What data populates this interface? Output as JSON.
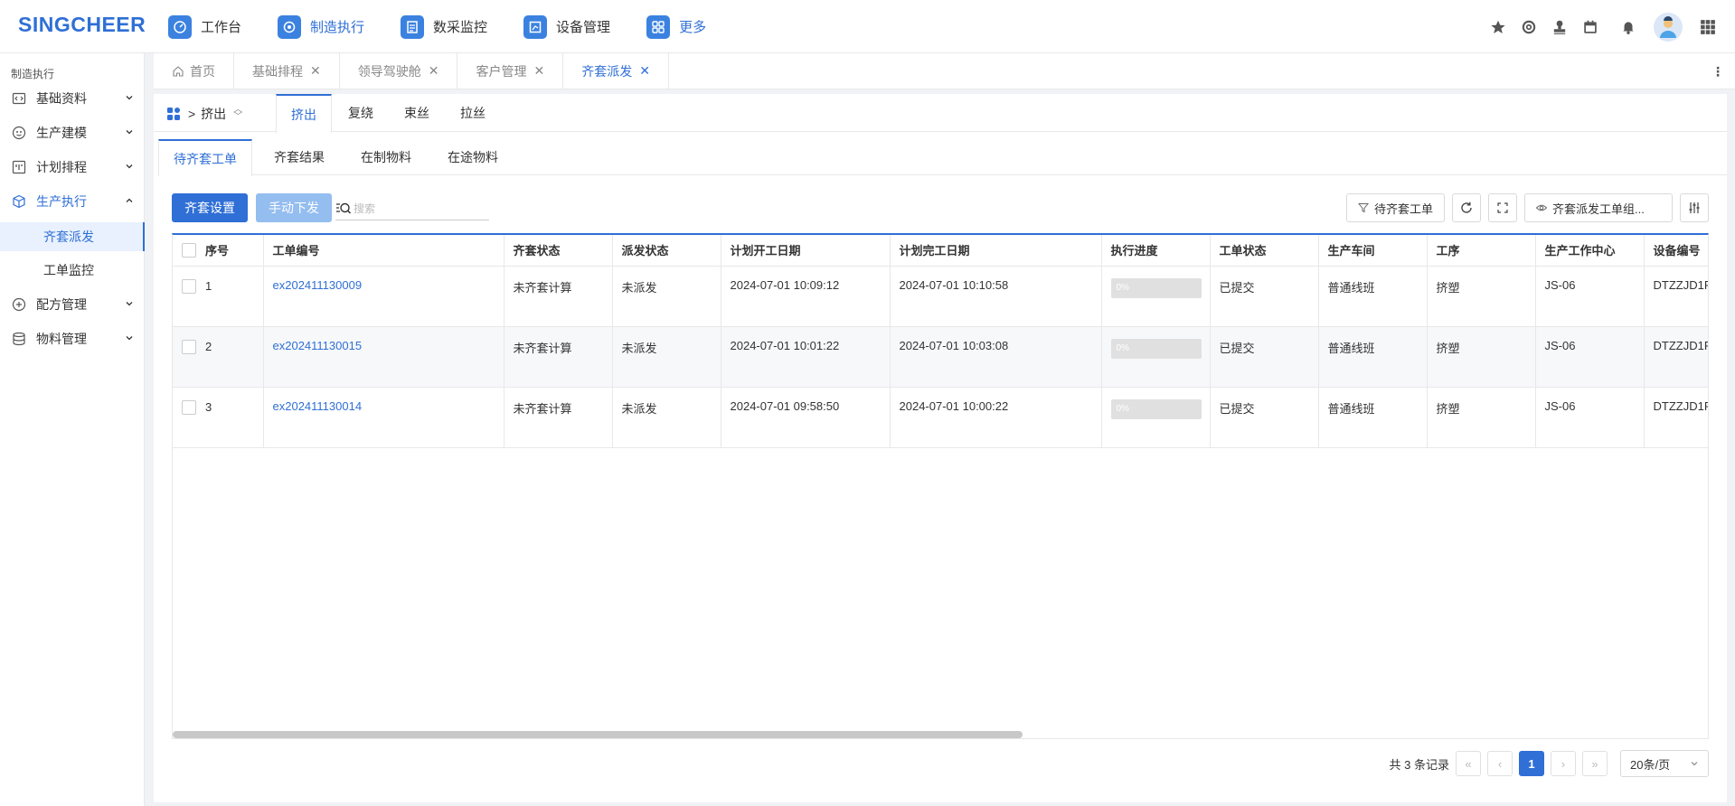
{
  "header": {
    "logo": "SINGCHEER",
    "nav": [
      {
        "label": "工作台",
        "icon": "dashboard-icon",
        "active": false
      },
      {
        "label": "制造执行",
        "icon": "manufacturing-icon",
        "active": true
      },
      {
        "label": "数采监控",
        "icon": "data-monitor-icon",
        "active": false
      },
      {
        "label": "设备管理",
        "icon": "equipment-icon",
        "active": false
      },
      {
        "label": "更多",
        "icon": "more-apps-icon",
        "active": false
      }
    ]
  },
  "sidebar": {
    "title": "制造执行",
    "items": [
      {
        "label": "基础资料"
      },
      {
        "label": "生产建模"
      },
      {
        "label": "计划排程"
      },
      {
        "label": "生产执行"
      },
      {
        "label": "配方管理"
      },
      {
        "label": "物料管理"
      }
    ],
    "subitems": [
      {
        "label": "齐套派发"
      },
      {
        "label": "工单监控"
      }
    ]
  },
  "tabs": [
    {
      "label": "首页"
    },
    {
      "label": "基础排程"
    },
    {
      "label": "领导驾驶舱"
    },
    {
      "label": "客户管理"
    },
    {
      "label": "齐套派发"
    }
  ],
  "process": {
    "crumb": "挤出",
    "tabs": [
      "挤出",
      "复绕",
      "束丝",
      "拉丝"
    ]
  },
  "subtabs": [
    "待齐套工单",
    "齐套结果",
    "在制物料",
    "在途物料"
  ],
  "toolbar": {
    "setup_label": "齐套设置",
    "manual_label": "手动下发",
    "search_placeholder": "搜索",
    "filter_label": "待齐套工单",
    "view_label": "齐套派发工单组..."
  },
  "table": {
    "headers": [
      "序号",
      "工单编号",
      "齐套状态",
      "派发状态",
      "计划开工日期",
      "计划完工日期",
      "执行进度",
      "工单状态",
      "生产车间",
      "工序",
      "生产工作中心",
      "设备编号"
    ],
    "rows": [
      {
        "seq": "1",
        "order": "ex202411130009",
        "kit": "未齐套计算",
        "dispatch": "未派发",
        "start": "2024-07-01 10:09:12",
        "end": "2024-07-01 10:10:58",
        "progress": "0%",
        "status": "已提交",
        "workshop": "普通线班",
        "process": "挤塑",
        "center": "JS-06",
        "equip": "DTZZJD1F"
      },
      {
        "seq": "2",
        "order": "ex202411130015",
        "kit": "未齐套计算",
        "dispatch": "未派发",
        "start": "2024-07-01 10:01:22",
        "end": "2024-07-01 10:03:08",
        "progress": "0%",
        "status": "已提交",
        "workshop": "普通线班",
        "process": "挤塑",
        "center": "JS-06",
        "equip": "DTZZJD1F"
      },
      {
        "seq": "3",
        "order": "ex202411130014",
        "kit": "未齐套计算",
        "dispatch": "未派发",
        "start": "2024-07-01 09:58:50",
        "end": "2024-07-01 10:00:22",
        "progress": "0%",
        "status": "已提交",
        "workshop": "普通线班",
        "process": "挤塑",
        "center": "JS-06",
        "equip": "DTZZJD1F"
      }
    ]
  },
  "pager": {
    "total": "共 3 条记录",
    "current": "1",
    "page_size": "20条/页"
  }
}
